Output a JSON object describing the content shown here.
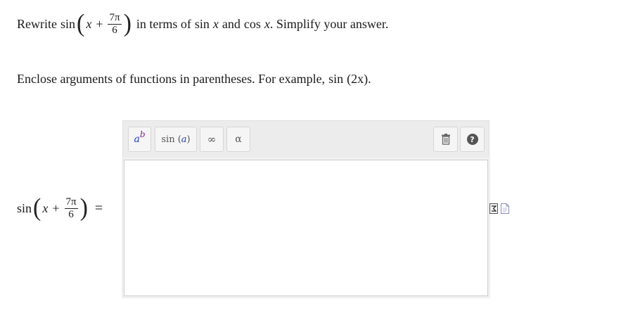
{
  "question": {
    "rewrite_word": "Rewrite",
    "sin_word": "sin",
    "x_var": "x",
    "plus": "+",
    "frac_num": "7π",
    "frac_den": "6",
    "rest_text_1": "in terms of",
    "sin_word_2": "sin",
    "x_var_2": "x",
    "and_word": "and",
    "cos_word": "cos",
    "x_var_3": "x",
    "rest_text_2": ". Simplify your answer."
  },
  "instruction": {
    "text": "Enclose arguments of functions in parentheses. For example,",
    "example_sin": "sin",
    "example_arg": "(2x)",
    "period": "."
  },
  "answer_label": {
    "sin_word": "sin",
    "x_var": "x",
    "plus": "+",
    "frac_num": "7π",
    "frac_den": "6",
    "equals": "="
  },
  "toolbar": {
    "power_base": "a",
    "power_exp": "b",
    "sin_label": "sin",
    "sin_arg": "a",
    "infinity_label": "∞",
    "alpha_label": "α",
    "trash_icon": "trash-icon",
    "help_label": "?"
  },
  "editor": {
    "value": ""
  },
  "side_icons": [
    "sigma-doc-icon",
    "document-icon"
  ],
  "colors": {
    "base_var": "#1f3fbf",
    "exponent_var": "#8a1f8a",
    "toolbar_bg": "#ececec"
  }
}
